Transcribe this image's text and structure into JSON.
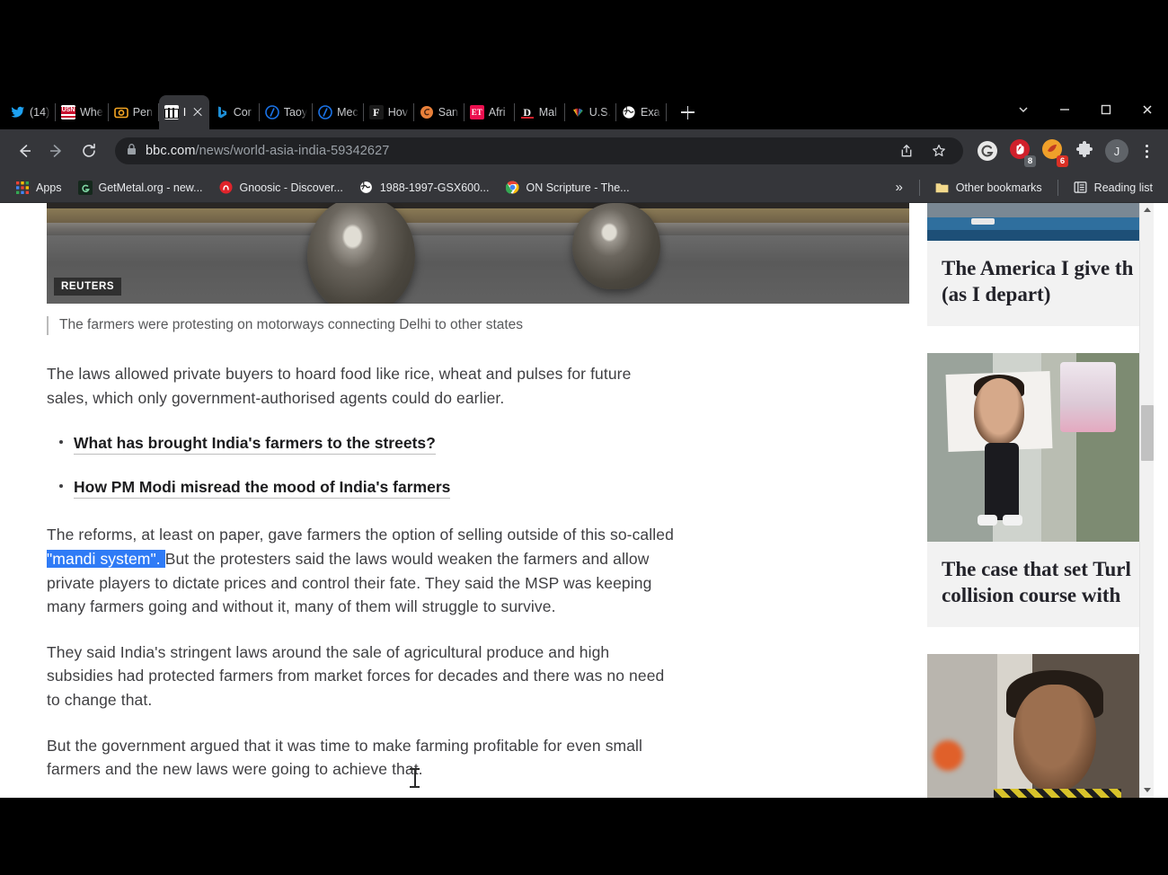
{
  "window": {
    "controls": [
      "chevron-down",
      "minimize",
      "maximize",
      "close"
    ]
  },
  "tabs": [
    {
      "title": "(14)",
      "icon": "twitter",
      "icon_color": "#1da1f2",
      "active": false
    },
    {
      "title": "Whe",
      "icon": "usn",
      "icon_color": "#c8102e",
      "active": false
    },
    {
      "title": "Pen",
      "icon": "camera",
      "icon_color": "#f5a623",
      "active": false
    },
    {
      "title": "I",
      "icon": "bbc",
      "icon_color": "#ffffff",
      "active": true
    },
    {
      "title": "Cor",
      "icon": "bing",
      "icon_color": "#1e8fd6",
      "active": false
    },
    {
      "title": "Taoy",
      "icon": "blue-circle",
      "icon_color": "#1a73e8",
      "active": false
    },
    {
      "title": "Mec",
      "icon": "blue-circle",
      "icon_color": "#1a73e8",
      "active": false
    },
    {
      "title": "Hov",
      "icon": "forbes-f",
      "icon_color": "#ffffff",
      "active": false
    },
    {
      "title": "San",
      "icon": "orange-swirl",
      "icon_color": "#e8803a",
      "active": false
    },
    {
      "title": "Afri",
      "icon": "et",
      "icon_color": "#ec0f4f",
      "active": false
    },
    {
      "title": "Mal",
      "icon": "drudge-d",
      "icon_color": "#ffffff",
      "active": false
    },
    {
      "title": "U.S.",
      "icon": "nbc-peacock",
      "icon_color": "#ffffff",
      "active": false
    },
    {
      "title": "Exa",
      "icon": "globe",
      "icon_color": "#ffffff",
      "active": false
    }
  ],
  "new_tab_label": "+",
  "toolbar": {
    "back_label": "Back",
    "forward_label": "Forward",
    "reload_label": "Reload",
    "lock_label": "Secure",
    "url_domain": "bbc.com",
    "url_path": "/news/world-asia-india-59342627",
    "share_label": "Share",
    "bookmark_label": "Bookmark this tab",
    "ext_grammarly": "Grammarly",
    "ext_red_badge": "8",
    "ext_red_badge_color": "#5f6368",
    "ext_orange_badge": "6",
    "ext_orange_badge_color": "#d93025",
    "ext_puzzle": "Extensions",
    "profile_initial": "J",
    "menu_label": "Customize and control Google Chrome"
  },
  "bookmarks": {
    "apps_label": "Apps",
    "items": [
      {
        "label": "GetMetal.org - new...",
        "icon": "getmetal",
        "color": "#1f3d2b"
      },
      {
        "label": "Gnoosic - Discover...",
        "icon": "gnoosic",
        "color": "#e0242b"
      },
      {
        "label": "1988-1997-GSX600...",
        "icon": "globe",
        "color": "#ffffff"
      },
      {
        "label": "ON Scripture - The...",
        "icon": "chrome",
        "color": "#4285f4"
      }
    ],
    "overflow_label": "»",
    "other_bookmarks_label": "Other bookmarks",
    "reading_list_label": "Reading list"
  },
  "article": {
    "image_credit": "REUTERS",
    "caption": "The farmers were protesting on motorways connecting Delhi to other states",
    "paragraph_1": "The laws allowed private buyers to hoard food like rice, wheat and pulses for future sales, which only government-authorised agents could do earlier.",
    "links": [
      "What has brought India's farmers to the streets?",
      "How PM Modi misread the mood of India's farmers"
    ],
    "paragraph_2_pre": "The reforms, at least on paper, gave farmers the option of selling outside of this so-called ",
    "paragraph_2_selected": "\"mandi system\". ",
    "paragraph_2_post": "But the protesters said the laws would weaken the farmers and allow private players to dictate prices and control their fate. They said the MSP was keeping many farmers going and without it, many of them will struggle to survive.",
    "paragraph_3": "They said India's stringent laws around the sale of agricultural produce and high subsidies had protected farmers from market forces for decades and there was no need to change that.",
    "paragraph_4": "But the government argued that it was time to make farming profitable for even small farmers and the new laws were going to achieve that."
  },
  "rail": {
    "cards": [
      {
        "title": "The America I give th\n(as I depart)",
        "title_line1": "The America I give th",
        "title_line2": "(as I depart)"
      },
      {
        "title_line1": "The case that set Turl",
        "title_line2": "collision course with "
      }
    ]
  },
  "colors": {
    "selection_blue": "#2f7bf6",
    "toolbar_bg": "#35363a",
    "tabstrip_bg": "#000000",
    "page_bg": "#ffffff",
    "card_bg": "#f2f2f2",
    "body_text": "#3f3f42"
  }
}
